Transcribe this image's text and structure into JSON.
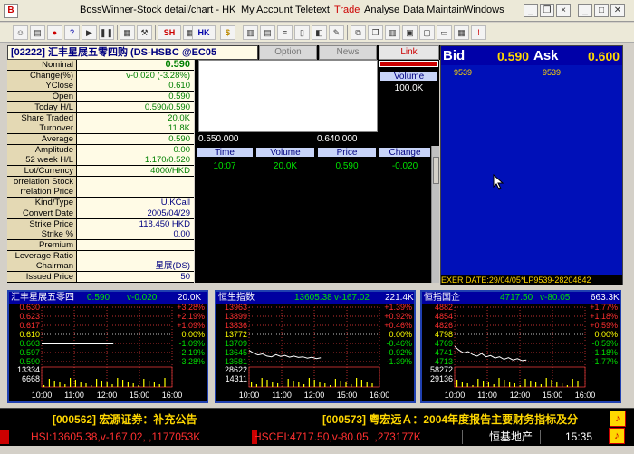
{
  "window": {
    "app_icon": "B",
    "title": "BossWinner-Stock detail/chart - HK"
  },
  "menu": [
    "My Account",
    "Teletext",
    "Trade",
    "Analyse",
    "Data Maintain",
    "Windows"
  ],
  "toolbar": {
    "sh_label": "SH",
    "hk_label": "HK",
    "dollar": "$"
  },
  "stock": {
    "title": "[02222] 汇丰星展五零四购 (DS-HSBC @EC05",
    "tabs": [
      "Option",
      "News",
      "Link"
    ],
    "fields": [
      {
        "label": "Nominal",
        "value": "0.590"
      },
      {
        "label": "Change(%)",
        "value": "v-0.020 (-3.28%)"
      },
      {
        "label": "YClose",
        "value": "0.610"
      },
      {
        "label": "Open",
        "value": "0.590"
      },
      {
        "label": "Today H/L",
        "value": "0.590/0.590"
      },
      {
        "label": "Share Traded",
        "value": "20.0K"
      },
      {
        "label": "Turnover",
        "value": "11.8K"
      },
      {
        "label": "Average",
        "value": "0.590"
      },
      {
        "label": "Amplitude",
        "value": "0.00"
      },
      {
        "label": "52 week H/L",
        "value": "1.170/0.520"
      },
      {
        "label": "Lot/Currency",
        "value": "4000/HKD"
      },
      {
        "label": "orrelation Stock",
        "value": ""
      },
      {
        "label": "rrelation Price",
        "value": ""
      },
      {
        "label": "Kind/Type",
        "value": "U.KCall"
      },
      {
        "label": "Convert Date",
        "value": "2005/04/29"
      },
      {
        "label": "Strike Price",
        "value": "118.450 HKD"
      },
      {
        "label": "Strike %",
        "value": "0.00"
      },
      {
        "label": "Premium",
        "value": ""
      },
      {
        "label": "Leverage Ratio",
        "value": ""
      },
      {
        "label": "Chairman",
        "value": "星展(DS)"
      },
      {
        "label": "Issued Price",
        "value": "50"
      }
    ]
  },
  "depth": {
    "volume_header": "Volume",
    "volume_value": "100.0K",
    "left_price": "0.550.000",
    "right_price": "0.640.000"
  },
  "trades": {
    "headers": [
      "Time",
      "Volume",
      "Price",
      "Change"
    ],
    "rows": [
      {
        "time": "10:07",
        "volume": "20.0K",
        "price": "0.590",
        "change": "-0.020"
      }
    ]
  },
  "bidask": {
    "bid_label": "Bid",
    "bid_price": "0.590",
    "ask_label": "Ask",
    "ask_price": "0.600",
    "bid_sub": "9539",
    "ask_sub": "9539",
    "exer": "EXER DATE:29/04/05*LP9539-28204842"
  },
  "minicharts": [
    {
      "name": "汇丰星展五零四",
      "price": "0.590",
      "change": "v-0.020",
      "volume": "20.0K",
      "left_ticks": [
        "0.630",
        "0.623",
        "0.617",
        "0.610",
        "0.603",
        "0.597",
        "0.590"
      ],
      "right_ticks": [
        "+3.28%",
        "+2.19%",
        "+1.09%",
        "0.00%",
        "-1.09%",
        "-2.19%",
        "-3.28%"
      ],
      "vol_ticks": [
        "13334",
        "6668"
      ],
      "times": [
        "10:00",
        "11:00",
        "12:00",
        "15:00",
        "16:00"
      ],
      "chart_data": {
        "type": "line",
        "series": [
          {
            "values": [
              0.603,
              0.603,
              0.603,
              0.603,
              0.603,
              0.603,
              0.603,
              0.603,
              0.603,
              0.603,
              0.603,
              0.603
            ]
          }
        ]
      }
    },
    {
      "name": "恒生指数",
      "price": "13605.38",
      "change": "v-167.02",
      "volume": "221.4K",
      "left_ticks": [
        "13963",
        "13899",
        "13836",
        "13772",
        "13709",
        "13645",
        "13581"
      ],
      "right_ticks": [
        "+1.39%",
        "+0.92%",
        "+0.46%",
        "0.00%",
        "-0.46%",
        "-0.92%",
        "-1.39%"
      ],
      "vol_ticks": [
        "28622",
        "14311"
      ],
      "times": [
        "10:00",
        "11:00",
        "12:00",
        "15:00",
        "16:00"
      ],
      "chart_data": {
        "type": "line",
        "series": [
          {
            "values": [
              13660,
              13640,
              13628,
              13635,
              13620,
              13615,
              13630,
              13618,
              13625,
              13612,
              13620,
              13610,
              13615,
              13605,
              13612,
              13602,
              13608
            ]
          }
        ]
      }
    },
    {
      "name": "恒指国企",
      "price": "4717.50",
      "change": "v-80.05",
      "volume": "663.3K",
      "left_ticks": [
        "4882",
        "4854",
        "4826",
        "4798",
        "4769",
        "4741",
        "4713"
      ],
      "right_ticks": [
        "+1.77%",
        "+1.18%",
        "+0.59%",
        "0.00%",
        "-0.59%",
        "-1.18%",
        "-1.77%"
      ],
      "vol_ticks": [
        "58272",
        "29136"
      ],
      "times": [
        "10:00",
        "11:00",
        "12:00",
        "15:00",
        "16:00"
      ],
      "chart_data": {
        "type": "line",
        "series": [
          {
            "values": [
              4760,
              4748,
              4740,
              4744,
              4735,
              4730,
              4738,
              4728,
              4732,
              4724,
              4728,
              4720,
              4725,
              4718,
              4722,
              4716,
              4718
            ]
          }
        ]
      }
    }
  ],
  "ticker": {
    "line1_left": "[000562] 宏源证券：补充公告",
    "line1_right": "[000573] 粤宏远Ａ：2004年度报告主要财务指标及分",
    "hsi": "HSI:13605.38,v-167.02, ,1177053K",
    "hscei": "HSCEI:4717.50,v-80.05, ,273177K",
    "sector": "恒基地产",
    "time": "15:35"
  },
  "colors": {
    "gain": "#ff3030",
    "loss": "#00e000",
    "flat": "#ffff00",
    "bidask_bg": "#0010b8"
  }
}
